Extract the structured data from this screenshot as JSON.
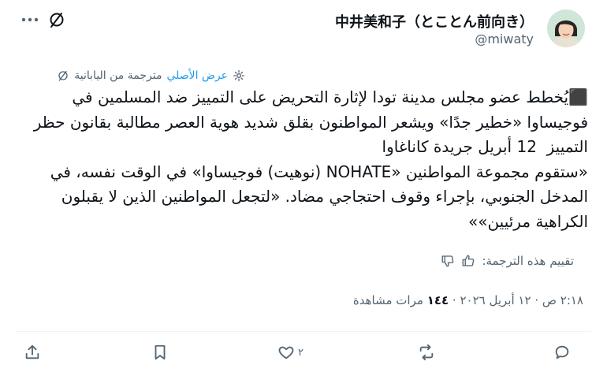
{
  "tweet": {
    "author": {
      "display_name": "中井美和子（とことん前向き）",
      "handle": "@miwaty"
    },
    "menu_icon": "more-icon",
    "translation": {
      "translated_from": "مترجمة من اليابانية",
      "show_original": "عرض الأصلي"
    },
    "body": "⬛يُخطط عضو مجلس مدينة تودا لإثارة التحريض على التمييز ضد المسلمين في فوجيساوا «خطير جدًا» ويشعر المواطنون بقلق شديد هوية العصر مطالبة بقانون حظر التمييز  12 أبريل جريدة كاناغاوا\n«ستقوم مجموعة المواطنين «NOHATE (نوهيت) فوجيساوا» في الوقت نفسه، في المدخل الجنوبي، بإجراء وقوف احتجاجي مضاد. «لتجعل المواطنين الذين لا يقبلون الكراهية مرئيين»»",
    "rate_translation": "تقييم هذه الترجمة:",
    "meta": {
      "time_date": "٢:١٨ ص · ١٢ أبريل ٢٠٢٦",
      "views_count": "١٤٤",
      "views_label": "مرات مشاهدة"
    },
    "actions": {
      "like_count": "٢"
    }
  }
}
